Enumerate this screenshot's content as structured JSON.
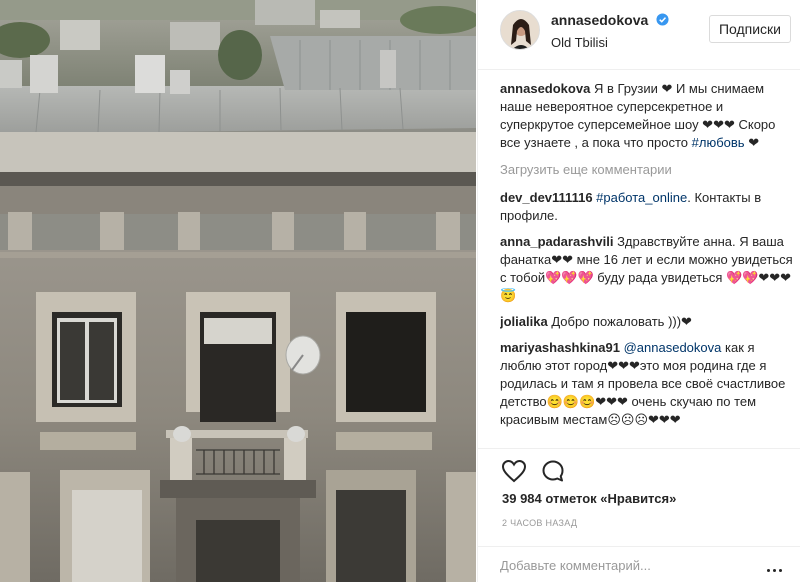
{
  "post": {
    "username": "annasedokova",
    "location": "Old Tbilisi",
    "follow_label": "Подписки",
    "caption": {
      "user": "annasedokova",
      "text": "Я в Грузии ❤ И мы снимаем наше невероятное суперсекретное и суперкрутое суперсемейное шоу ❤❤❤ Скоро все узнаете , а пока что просто ",
      "hashtag": "#любовь",
      "suffix": " ❤"
    },
    "load_more_label": "Загрузить еще комментарии",
    "comments": [
      {
        "user": "dev_dev111116",
        "text_before": " ",
        "tag": "#paбота_online",
        "text_after": ". Контакты в профиле."
      },
      {
        "user": "anna_padarashvili",
        "text_before": " Здравствуйте анна. Я ваша фанатка❤❤ мне 16 лет и если можно увидеться с тобой💖💖💖 буду рада увидеться 💖💖❤❤❤😇",
        "tag": "",
        "text_after": ""
      },
      {
        "user": "jolialika",
        "text_before": " Добро пожаловать )))❤",
        "tag": "",
        "text_after": ""
      },
      {
        "user": "mariyashashkina91",
        "text_before": " ",
        "tag": "@annasedokova",
        "text_after": " как я люблю этот город❤❤❤это моя родина где я родилась и там я провела все своё счастливое детство😊😊😊❤❤❤ очень скучаю по тем красивым местам☹☹☹❤❤❤"
      }
    ],
    "likes_text": "39 984 отметок «Нравится»",
    "time_text": "2 часов назад",
    "add_comment_placeholder": "Добавьте комментарий..."
  },
  "icons": {
    "verified": "verified-badge-icon",
    "like": "heart-outline-icon",
    "comment": "speech-bubble-icon",
    "more": "more-options-icon"
  },
  "colors": {
    "text": "#262626",
    "muted": "#999999",
    "link": "#003569",
    "verified": "#3897f0",
    "border": "#efefef"
  }
}
